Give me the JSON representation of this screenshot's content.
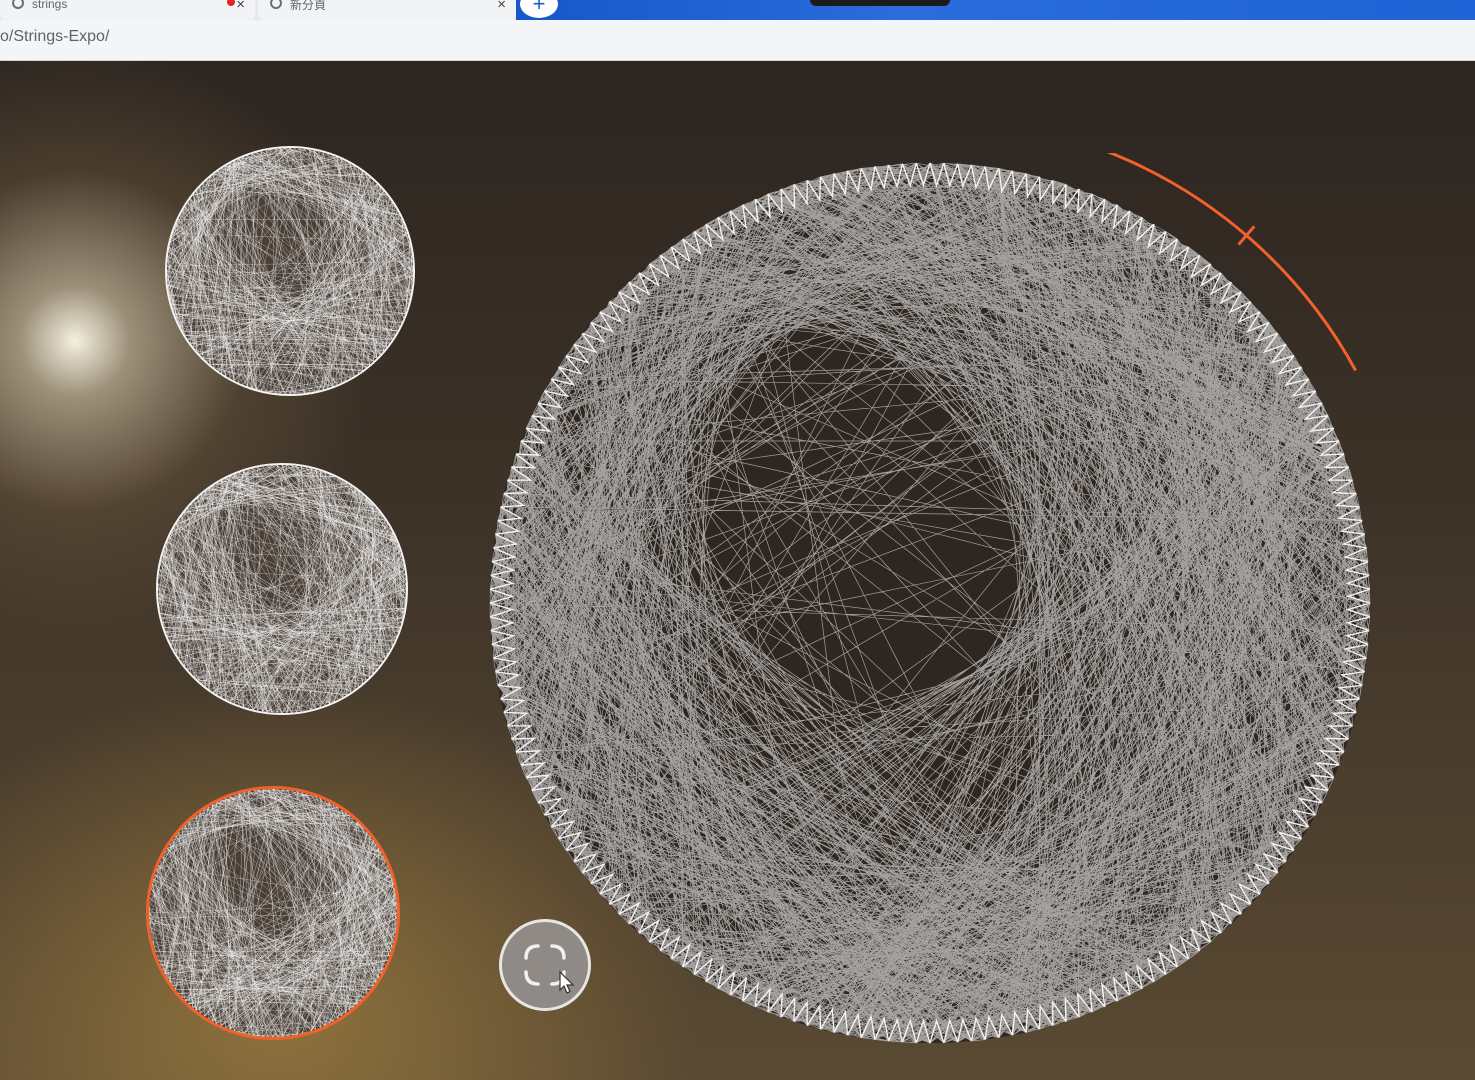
{
  "browser": {
    "tabs": [
      {
        "label": "strings",
        "has_recording_dot": true
      },
      {
        "label": "新分頁",
        "has_recording_dot": false
      }
    ],
    "close_glyph": "×",
    "new_tab_glyph": "+",
    "url": "o/Strings-Expo/"
  },
  "colors": {
    "accent": "#f2612a",
    "thread": "#f3f3f3",
    "browser_blue": "#1f63d6"
  },
  "gallery": {
    "thumbnails": [
      {
        "name": "string-art-thumbnail-1",
        "selected": false
      },
      {
        "name": "string-art-thumbnail-2",
        "selected": false
      },
      {
        "name": "string-art-thumbnail-3",
        "selected": true
      }
    ]
  },
  "viewer": {
    "main_artwork": "string-art-portrait",
    "progress_arc_icon": "progress-arc-icon",
    "fullscreen_icon": "fullscreen-icon",
    "cursor_icon": "cursor-icon"
  }
}
